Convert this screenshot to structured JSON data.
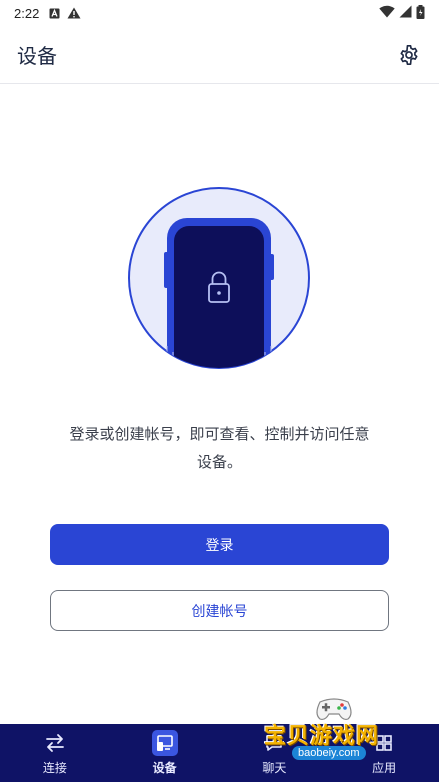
{
  "status_bar": {
    "time": "2:22"
  },
  "app_bar": {
    "title": "设备"
  },
  "empty_state": {
    "message_line1": "登录或创建帐号，即可查看、控制并访问任意",
    "message_line2": "设备。"
  },
  "buttons": {
    "login": "登录",
    "create_account": "创建帐号"
  },
  "bottom_nav": {
    "items": [
      {
        "label": "连接",
        "icon": "transfer-arrows-icon",
        "active": false
      },
      {
        "label": "设备",
        "icon": "devices-icon",
        "active": true
      },
      {
        "label": "聊天",
        "icon": "chat-icon",
        "active": false
      },
      {
        "label": "应用",
        "icon": "apps-icon",
        "active": false
      }
    ]
  },
  "watermark": {
    "title": "宝贝游戏网",
    "url": "baobeiy.com"
  },
  "colors": {
    "primary": "#2a45d4",
    "nav_background": "#0f1366",
    "illustration_fill": "#e8ebfb",
    "phone_screen": "#0d0f5a"
  }
}
